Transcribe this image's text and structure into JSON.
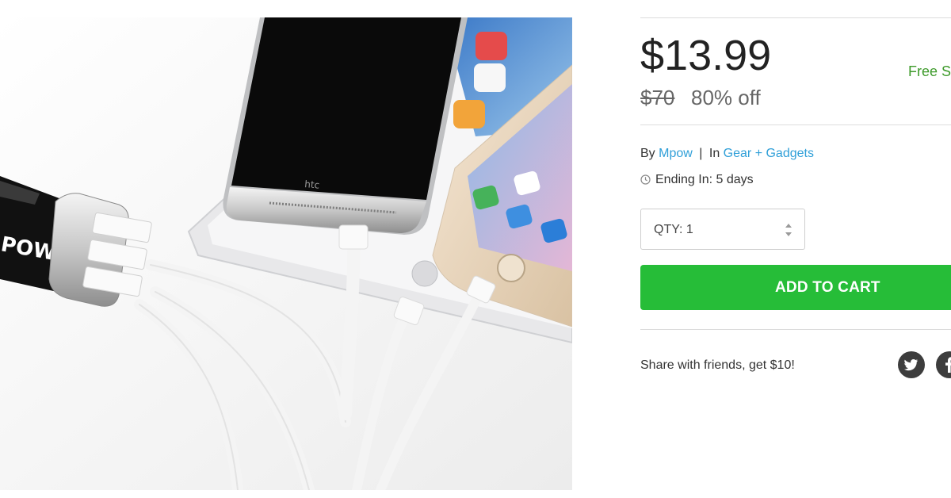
{
  "product": {
    "image_alt": "Mpow 3-port USB car charger charging HTC phone, iPhone and iPad",
    "charger_logo_text": "POW",
    "phone_brand_text": "htc"
  },
  "pricing": {
    "price": "$13.99",
    "original_price": "$70",
    "discount": "80% off",
    "free_shipping": "Free Sh"
  },
  "meta": {
    "by_label": "By",
    "brand": "Mpow",
    "separator": "|",
    "in_label": "In",
    "category": "Gear + Gadgets",
    "ending": "Ending In: 5 days"
  },
  "quantity": {
    "label": "QTY: 1"
  },
  "cart": {
    "add_label": "ADD TO CART"
  },
  "share": {
    "text": "Share with friends, get $10!",
    "networks": [
      "twitter-icon",
      "facebook-icon"
    ]
  },
  "colors": {
    "accent_green": "#26bd38",
    "link_blue": "#2f9fd8",
    "free_shipping_green": "#3d9a2a",
    "icon_gray": "#3d3d3d"
  }
}
